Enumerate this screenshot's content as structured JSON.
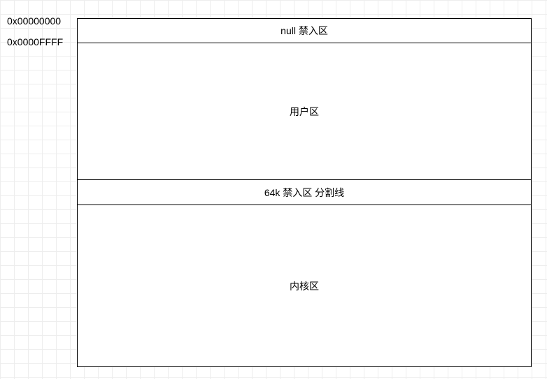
{
  "addresses": {
    "addr1": "0x00000000",
    "addr2": "0x0000FFFF"
  },
  "regions": {
    "null_label": "null 禁入区",
    "user_label": "用户区",
    "divider_label": "64k 禁入区 分割线",
    "kernel_label": "内核区"
  }
}
